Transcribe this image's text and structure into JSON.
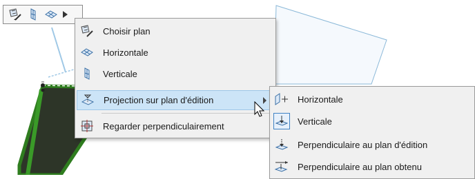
{
  "toolbar": {
    "buttons": [
      {
        "icon": "choose-plane-icon"
      },
      {
        "icon": "vertical-plane-icon"
      },
      {
        "icon": "horizontal-plane-icon"
      }
    ],
    "more": {
      "icon": "triangle-right-icon"
    }
  },
  "main_menu": {
    "items": [
      {
        "label": "Choisir plan",
        "icon": "choose-plane-icon"
      },
      {
        "label": "Horizontale",
        "icon": "horizontal-plane-icon"
      },
      {
        "label": "Verticale",
        "icon": "vertical-plane-icon"
      },
      {
        "label": "Projection sur plan d'édition",
        "icon": "projection-icon",
        "highlighted": true,
        "has_submenu": true
      },
      {
        "label": "Regarder perpendiculairement",
        "icon": "look-perpendicular-icon"
      }
    ]
  },
  "sub_menu": {
    "items": [
      {
        "label": "Horizontale",
        "icon": "horizontal-projection-icon"
      },
      {
        "label": "Verticale",
        "icon": "vertical-projection-icon",
        "selected": true
      },
      {
        "label": "Perpendiculaire au plan d'édition",
        "icon": "perpendicular-edit-plane-icon"
      },
      {
        "label": "Perpendiculaire au plan obtenu",
        "icon": "perpendicular-obtained-plane-icon"
      }
    ]
  },
  "colors": {
    "menu_bg": "#f0f0f0",
    "highlight": "#cce4f7",
    "selection_green": "#2f7d1f",
    "plane_fill": "#2d3528",
    "guide_blue": "#8ab8d8"
  }
}
